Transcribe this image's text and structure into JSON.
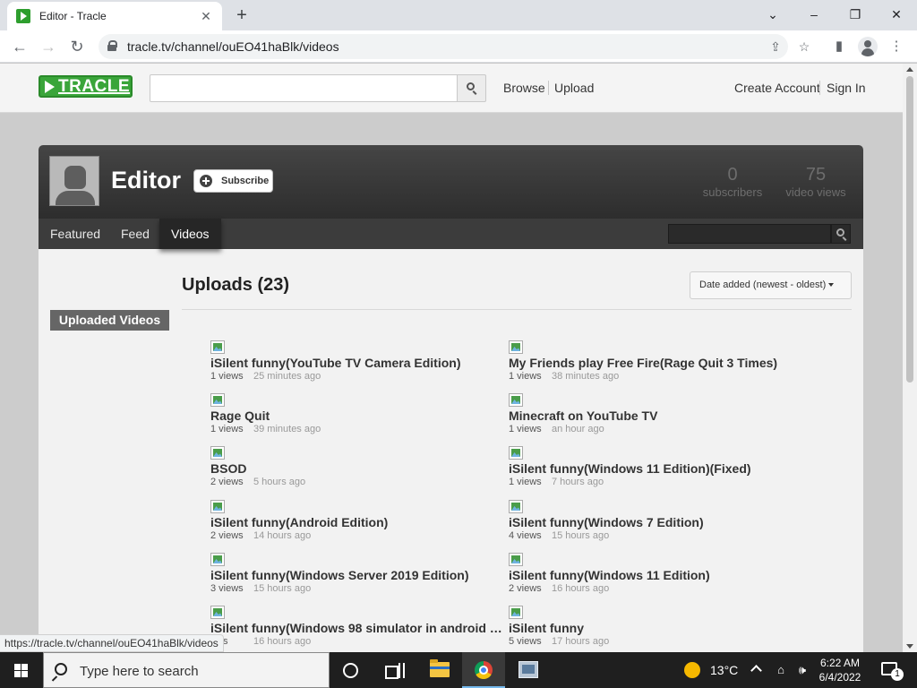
{
  "browser": {
    "tab_title": "Editor - Tracle",
    "tab_close": "✕",
    "new_tab": "+",
    "url": "tracle.tv/channel/ouEO41haBlk/videos",
    "status_url": "https://tracle.tv/channel/ouEO41haBlk/videos",
    "controls": {
      "minimize": "–",
      "restore": "❐",
      "close": "✕",
      "tab_menu": "⌄"
    },
    "nav": {
      "back": "←",
      "forward": "→",
      "reload": "↻"
    },
    "icons": {
      "share": "⇪",
      "star": "☆",
      "sidepanel": "▮",
      "menu": "⋮"
    }
  },
  "site": {
    "logo": "TRACLE",
    "search_placeholder": "",
    "nav": {
      "browse": "Browse",
      "upload": "Upload",
      "create_account": "Create Account",
      "sign_in": "Sign In"
    },
    "brand_color": "#3aa53a"
  },
  "channel": {
    "name": "Editor",
    "subscribe_label": "Subscribe",
    "stats": {
      "subscribers_count": "0",
      "subscribers_label": "subscribers",
      "views_count": "75",
      "views_label": "video views"
    },
    "tabs": [
      {
        "label": "Featured"
      },
      {
        "label": "Feed"
      },
      {
        "label": "Videos",
        "active": true
      }
    ],
    "sidebar_button": "Uploaded Videos",
    "uploads_title": "Uploads (23)",
    "sort_label": "Date added (newest - oldest)"
  },
  "videos": [
    {
      "title": "iSilent funny(YouTube TV Camera Edition)",
      "views": "1 views",
      "ago": "25 minutes ago"
    },
    {
      "title": "My Friends play Free Fire(Rage Quit 3 Times)",
      "views": "1 views",
      "ago": "38 minutes ago"
    },
    {
      "title": "Rage Quit",
      "views": "1 views",
      "ago": "39 minutes ago"
    },
    {
      "title": "Minecraft on YouTube TV",
      "views": "1 views",
      "ago": "an hour ago"
    },
    {
      "title": "BSOD",
      "views": "2 views",
      "ago": "5 hours ago"
    },
    {
      "title": "iSilent funny(Windows 11 Edition)(Fixed)",
      "views": "1 views",
      "ago": "7 hours ago"
    },
    {
      "title": "iSilent funny(Android Edition)",
      "views": "2 views",
      "ago": "14 hours ago"
    },
    {
      "title": "iSilent funny(Windows 7 Edition)",
      "views": "4 views",
      "ago": "15 hours ago"
    },
    {
      "title": "iSilent funny(Windows Server 2019 Edition)",
      "views": "3 views",
      "ago": "15 hours ago"
    },
    {
      "title": "iSilent funny(Windows 11 Edition)",
      "views": "2 views",
      "ago": "16 hours ago"
    },
    {
      "title": "iSilent funny(Windows 98 simulator in android E...",
      "views": "ews",
      "ago": "16 hours ago"
    },
    {
      "title": "iSilent funny",
      "views": "5 views",
      "ago": "17 hours ago"
    }
  ],
  "taskbar": {
    "search_placeholder": "Type here to search",
    "temperature": "13°C",
    "time": "6:22 AM",
    "date": "6/4/2022",
    "notification_count": "1",
    "tray": {
      "network": "⌂",
      "volume": "🕪"
    }
  }
}
